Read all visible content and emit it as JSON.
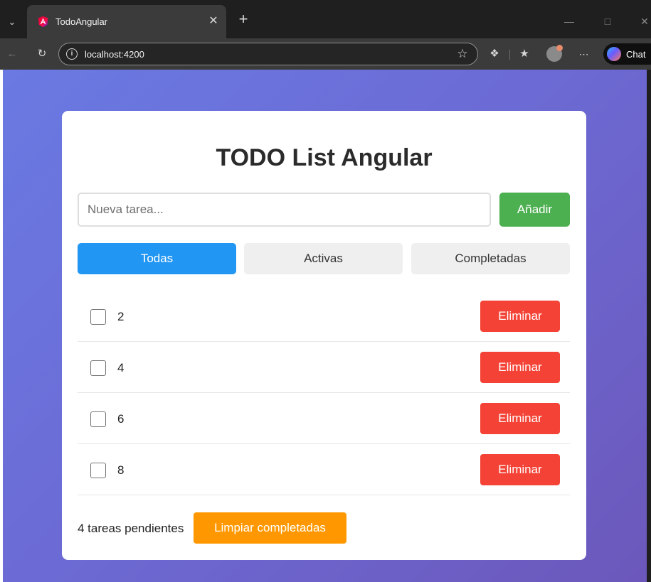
{
  "browser": {
    "tab_title": "TodoAngular",
    "url": "localhost:4200",
    "copilot_label": "Chat"
  },
  "app": {
    "title": "TODO List Angular",
    "input": {
      "placeholder": "Nueva tarea...",
      "value": ""
    },
    "add_label": "Añadir",
    "filters": [
      {
        "label": "Todas",
        "active": true
      },
      {
        "label": "Activas",
        "active": false
      },
      {
        "label": "Completadas",
        "active": false
      }
    ],
    "todos": [
      {
        "text": "2",
        "completed": false,
        "delete_label": "Eliminar"
      },
      {
        "text": "4",
        "completed": false,
        "delete_label": "Eliminar"
      },
      {
        "text": "6",
        "completed": false,
        "delete_label": "Eliminar"
      },
      {
        "text": "8",
        "completed": false,
        "delete_label": "Eliminar"
      }
    ],
    "pending_text": "4 tareas pendientes",
    "clear_label": "Limpiar completadas"
  },
  "colors": {
    "add_button": "#4caf50",
    "active_filter": "#2196f3",
    "delete_button": "#f44336",
    "clear_button": "#ff9800",
    "background_start": "#6a7ae2",
    "background_end": "#6c58bb"
  },
  "icons": {
    "tab_favicon": "angular-icon",
    "browser_actions": [
      "back-arrow-icon",
      "reload-icon",
      "info-icon",
      "star-icon",
      "extensions-icon",
      "favorites-icon",
      "profile-icon",
      "more-icon",
      "copilot-icon"
    ]
  }
}
